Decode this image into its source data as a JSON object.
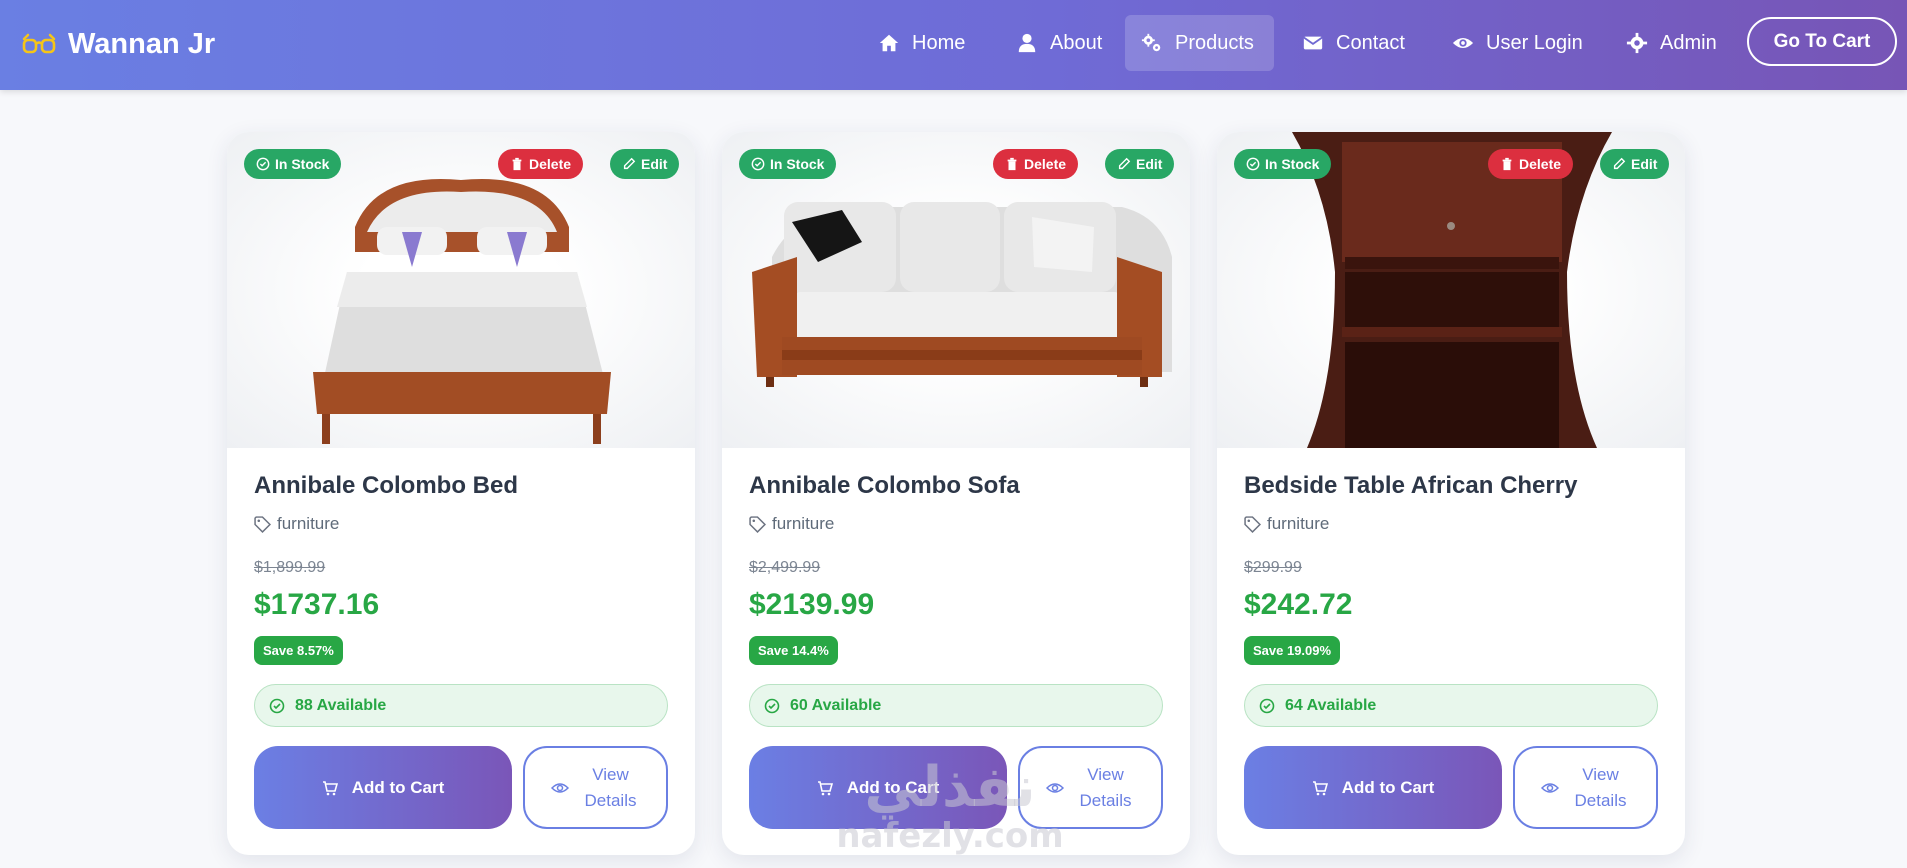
{
  "brand": {
    "name": "Wannan Jr",
    "icon": "glasses-icon"
  },
  "nav": {
    "items": [
      {
        "label": "Home",
        "icon": "home-icon"
      },
      {
        "label": "About",
        "icon": "user-icon"
      },
      {
        "label": "Products",
        "icon": "gears-icon",
        "active": true
      },
      {
        "label": "Contact",
        "icon": "envelope-icon"
      },
      {
        "label": "User Login",
        "icon": "eye-icon"
      },
      {
        "label": "Admin",
        "icon": "gear-icon"
      }
    ],
    "cart_button": "Go To Cart"
  },
  "colors": {
    "nav_start": "#6a7fe3",
    "nav_end": "#7755b6",
    "success": "#28a745",
    "danger": "#dc2f3f",
    "accent": "#6a7fe3"
  },
  "badges": {
    "stock": "In Stock",
    "delete": "Delete",
    "edit": "Edit"
  },
  "buttons": {
    "add_to_cart": "Add to Cart",
    "view_details": "View Details"
  },
  "products": [
    {
      "title": "Annibale Colombo Bed",
      "category": "furniture",
      "old_price": "$1,899.99",
      "price": "$1737.16",
      "save": "Save 8.57%",
      "available": "88 Available",
      "image": "bed"
    },
    {
      "title": "Annibale Colombo Sofa",
      "category": "furniture",
      "old_price": "$2,499.99",
      "price": "$2139.99",
      "save": "Save 14.4%",
      "available": "60 Available",
      "image": "sofa"
    },
    {
      "title": "Bedside Table African Cherry",
      "category": "furniture",
      "old_price": "$299.99",
      "price": "$242.72",
      "save": "Save 19.09%",
      "available": "64 Available",
      "image": "bedside-table"
    }
  ],
  "watermark": {
    "arabic": "نفذلي",
    "latin": "nafezly.com"
  }
}
